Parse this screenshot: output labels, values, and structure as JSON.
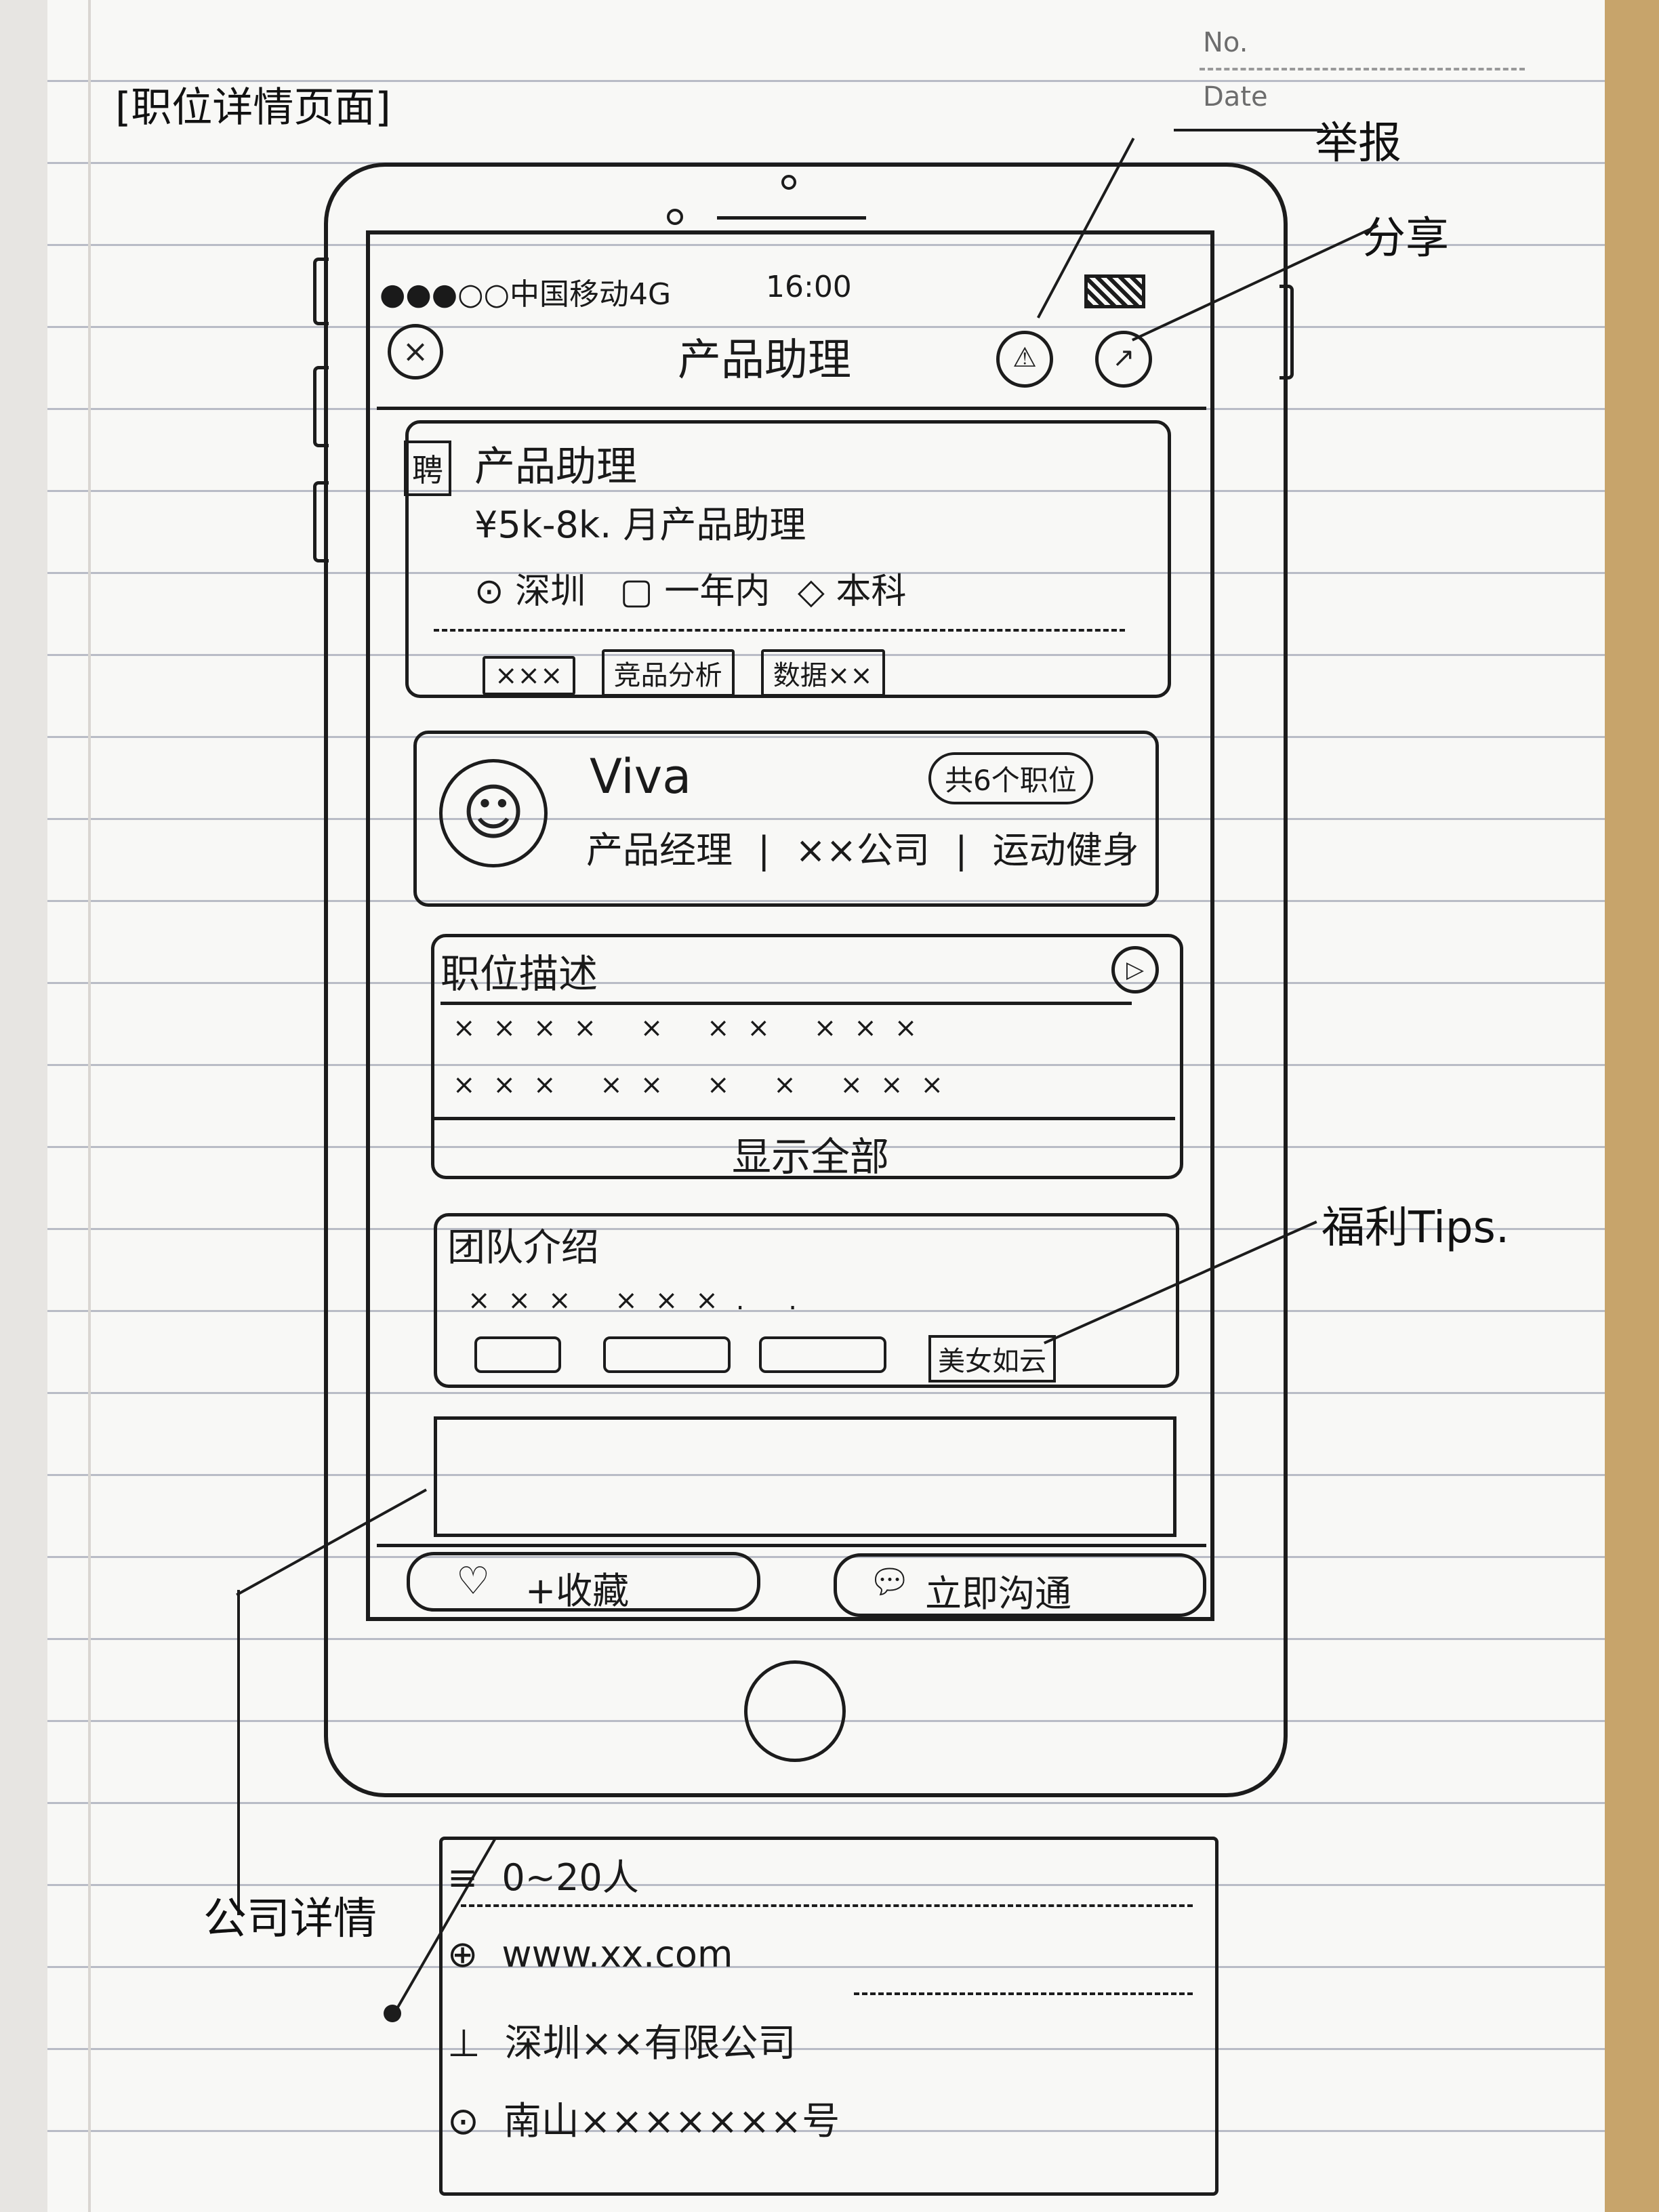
{
  "page_heading": "[职位详情页面]",
  "notebook": {
    "no_label": "No.",
    "date_label": "Date"
  },
  "status_bar": {
    "carrier": "●●●○○中国移动4G",
    "time": "16:00"
  },
  "nav": {
    "title": "产品助理"
  },
  "job_card": {
    "badge": "聘",
    "title": "产品助理",
    "salary_line": "¥5k-8k. 月产品助理",
    "location": "深圳",
    "experience": "一年内",
    "education": "本科",
    "tags": [
      "×××",
      "竞品分析",
      "数据××"
    ]
  },
  "recruiter": {
    "name": "Viva",
    "job_count": "共6个职位",
    "role": "产品经理",
    "company": "××公司",
    "industry": "运动健身"
  },
  "description": {
    "heading": "职位描述",
    "row1": "×××× × ×× ×××",
    "row2": "××× ×× × × ×××",
    "show_all": "显示全部"
  },
  "team": {
    "heading": "团队介绍",
    "row": "××× ×××. .",
    "tag4": "美女如云"
  },
  "bottom_bar": {
    "favorite": "+收藏",
    "chat": "立即沟通"
  },
  "annotations": {
    "report": "举报",
    "share": "分享",
    "perk_tips": "福利Tips.",
    "company_details": "公司详情"
  },
  "company_panel": {
    "size": "0~20人",
    "website": "www.xx.com",
    "company_name": "深圳××有限公司",
    "address": "南山×××××××号"
  },
  "icons": {
    "close": "close-icon",
    "report": "alarm-icon",
    "share": "share-icon",
    "location": "location-pin-icon",
    "experience": "briefcase-icon",
    "education": "graduation-cap-icon",
    "avatar": "avatar-icon",
    "expand": "expand-icon",
    "heart": "heart-icon",
    "chat": "chat-bubble-icon",
    "company_size": "list-icon",
    "website": "globe-icon",
    "company": "building-icon"
  }
}
